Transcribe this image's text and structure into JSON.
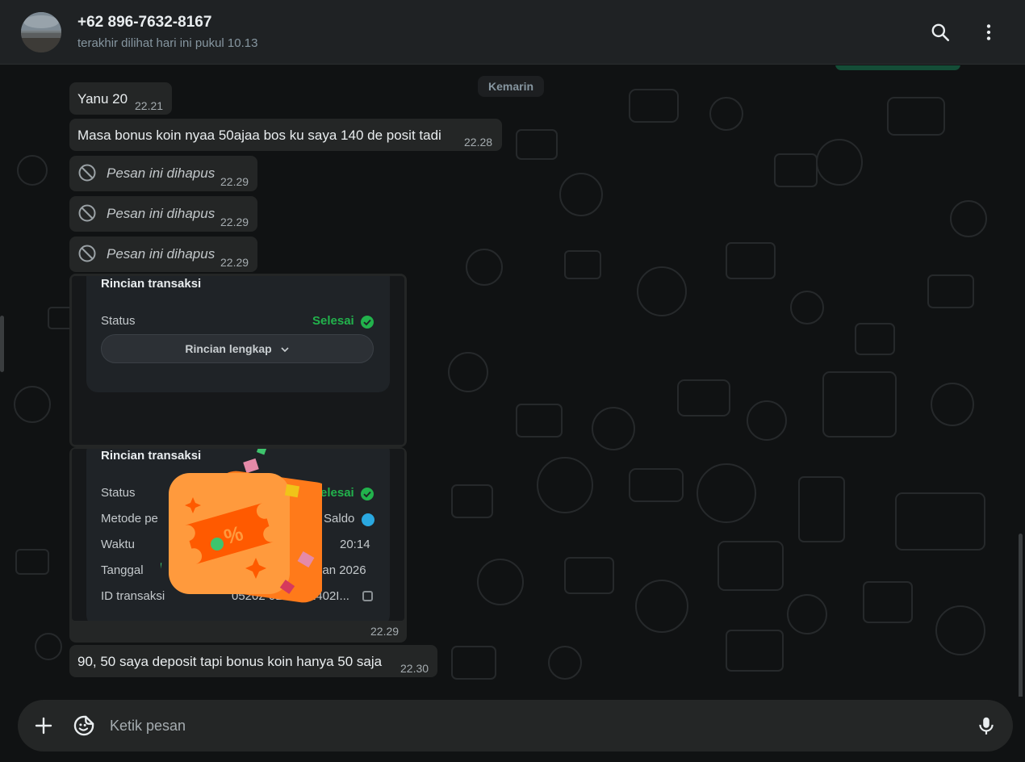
{
  "header": {
    "contact_name": "+62 896-7632-8167",
    "status": "terakhir dilihat hari ini pukul 10.13",
    "icons": [
      "search-icon",
      "more-vertical-icon"
    ]
  },
  "chat": {
    "date_chip": "Kemarin",
    "messages": [
      {
        "text": "Yanu 20",
        "time": "22.21"
      },
      {
        "text": "Masa bonus koin nyaa 50ajaa bos ku saya 140 de posit tadi",
        "time": "22.28"
      },
      {
        "text": "Pesan ini dihapus",
        "time": "22.29",
        "deleted": true
      },
      {
        "text": "Pesan ini dihapus",
        "time": "22.29",
        "deleted": true
      },
      {
        "text": "Pesan ini dihapus",
        "time": "22.29",
        "deleted": true
      },
      {
        "text": "90, 50 saya deposit tapi bonus koin hanya 50 saja",
        "time": "22.30"
      }
    ],
    "image1": {
      "title": "Rincian transaksi",
      "status_label": "Status",
      "status_value": "Selesai",
      "details_button": "Rincian lengkap"
    },
    "image2": {
      "title": "Rincian transaksi",
      "time": "22.29",
      "rows": [
        {
          "label": "Status",
          "value": "Selesai"
        },
        {
          "label": "Metode pe",
          "value": "Pay Saldo"
        },
        {
          "label": "Waktu",
          "value": "20:14"
        },
        {
          "label": "Tanggal",
          "value": "09 Jan 2026"
        },
        {
          "label": "ID transaksi",
          "value": "05202 0109131402I..."
        }
      ]
    }
  },
  "composer": {
    "placeholder": "Ketik pesan",
    "icons": [
      "plus-icon",
      "sticker-icon",
      "microphone-icon"
    ]
  },
  "colors": {
    "background": "#101213",
    "bubble": "#242626",
    "accent_green": "#22b24c",
    "promo_orange": "#ff9a3d"
  }
}
